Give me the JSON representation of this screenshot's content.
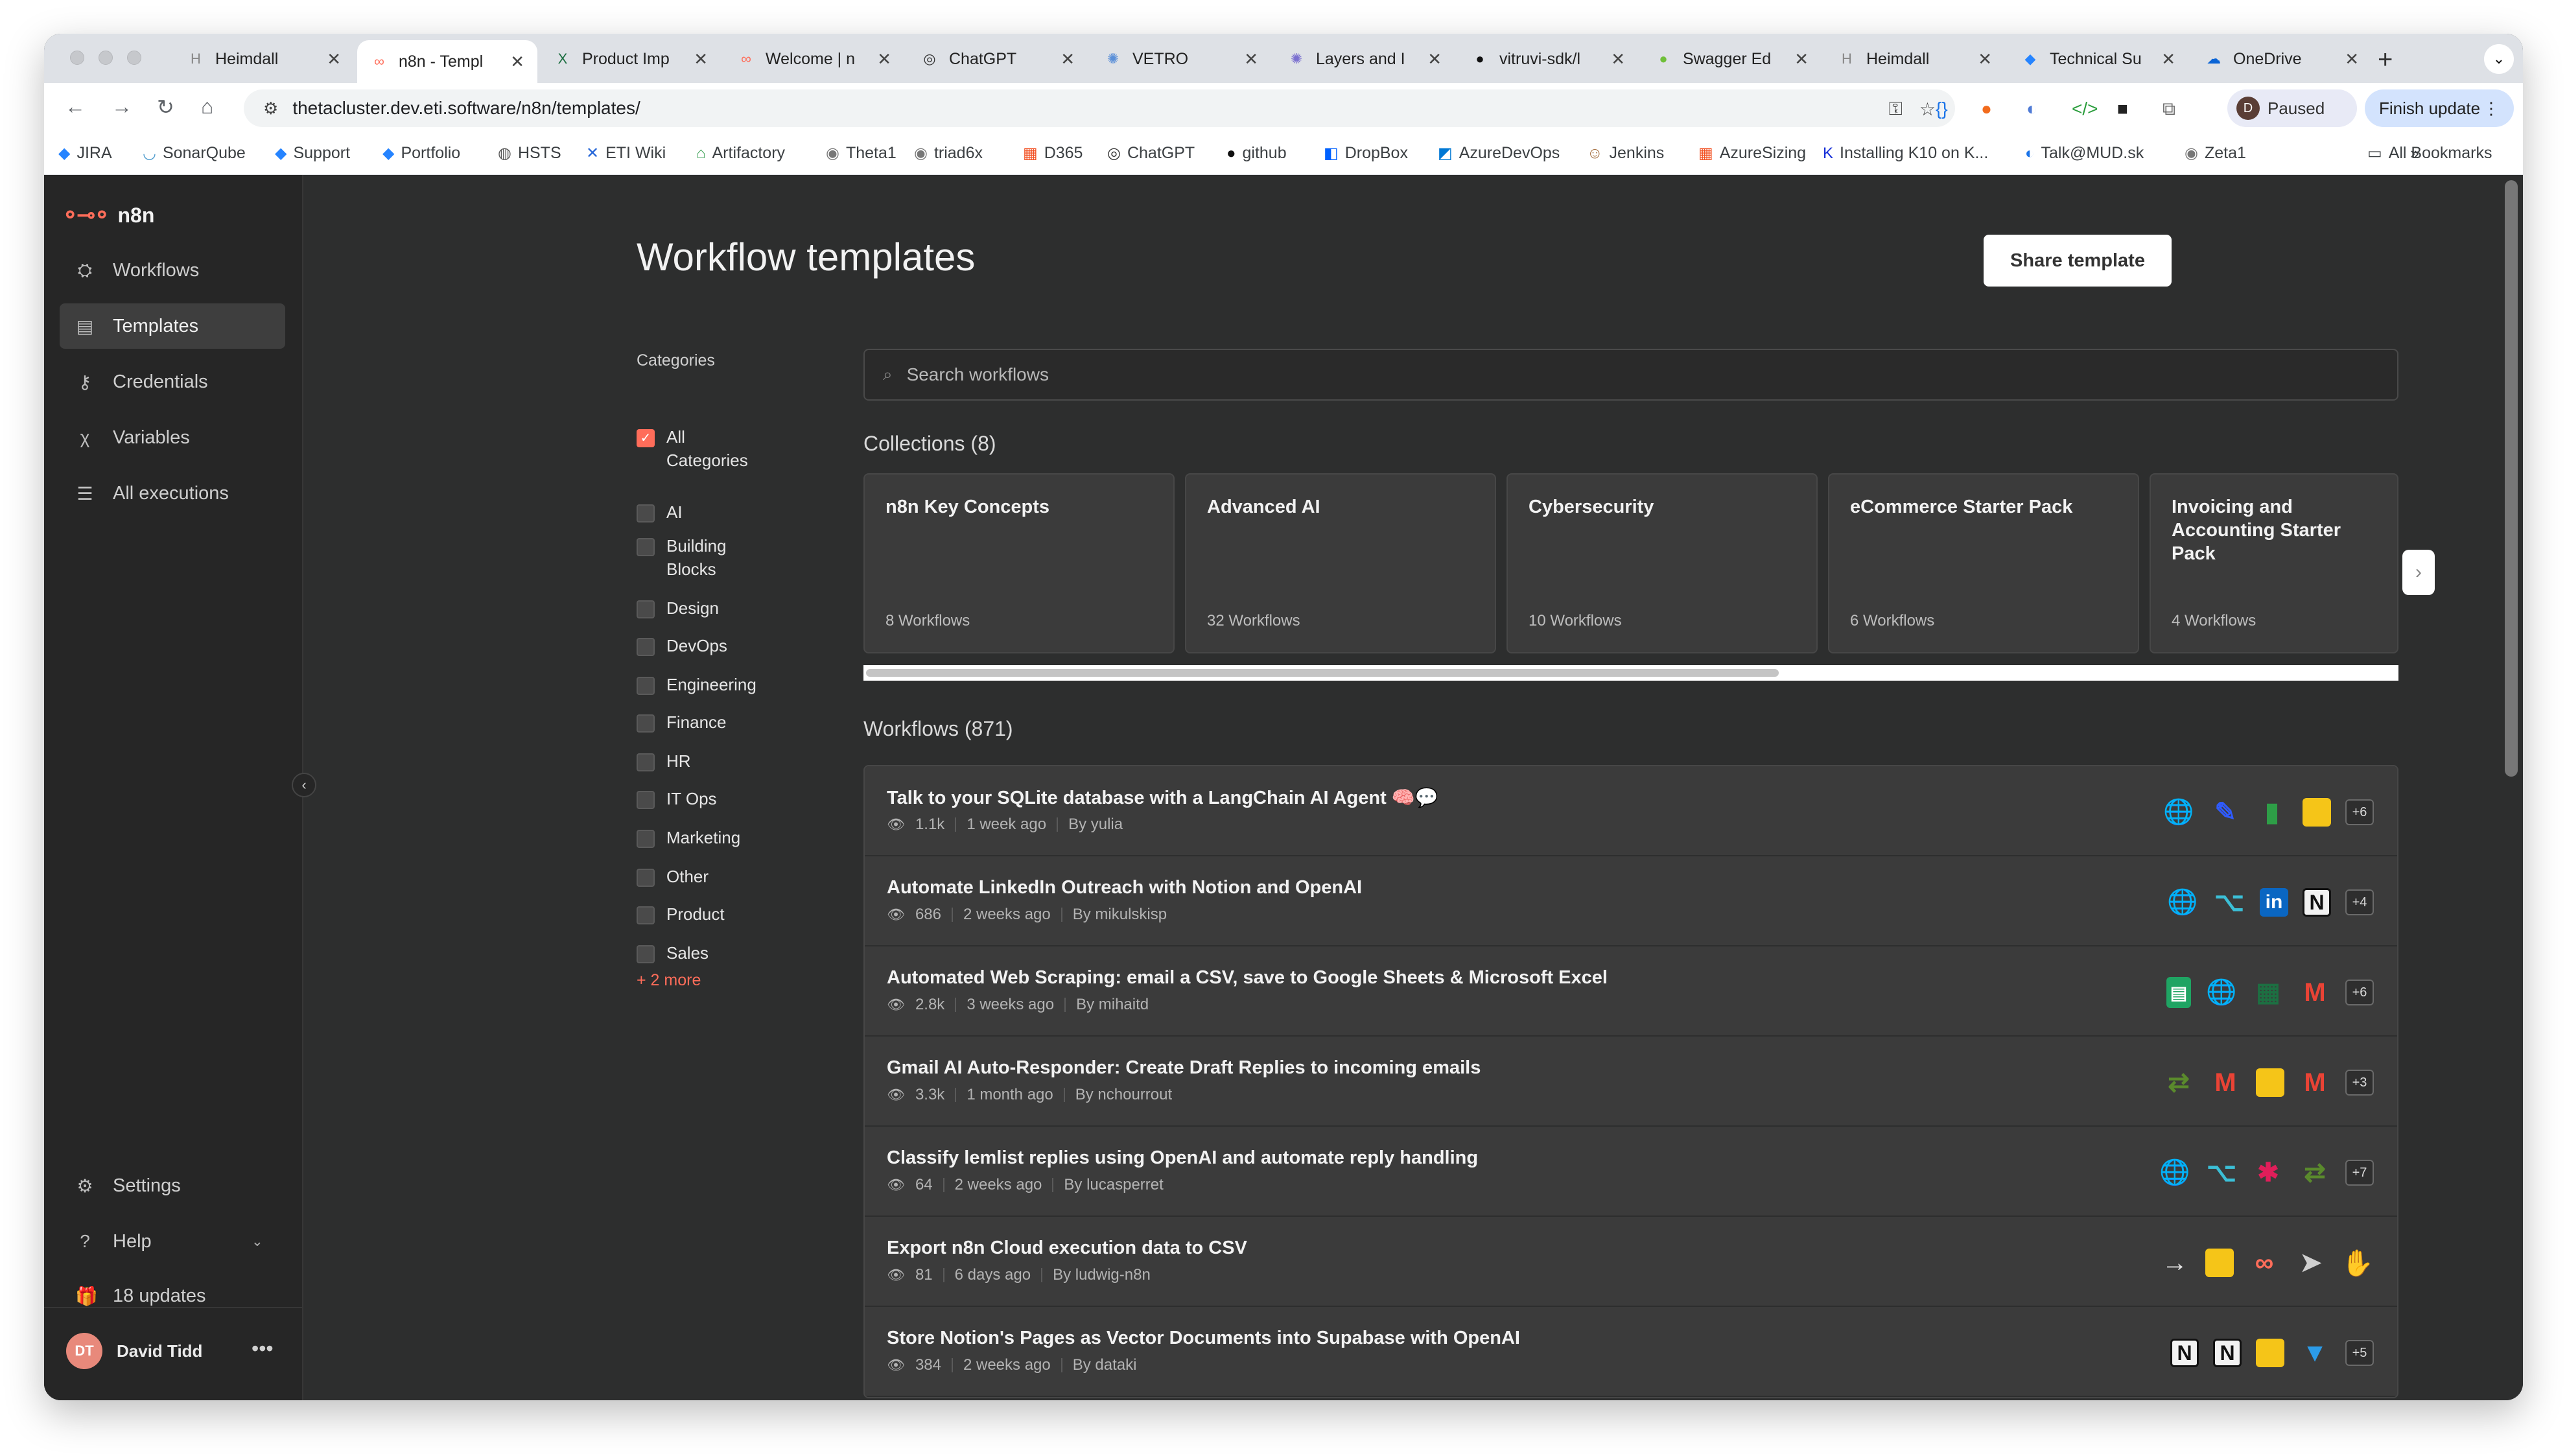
{
  "browser": {
    "tabs": [
      {
        "title": "Heimdall",
        "icon": "H",
        "active": false
      },
      {
        "title": "n8n - Templ",
        "icon": "n8n",
        "active": true
      },
      {
        "title": "Product Imp",
        "icon": "X",
        "active": false
      },
      {
        "title": "Welcome | n",
        "icon": "n8n",
        "active": false
      },
      {
        "title": "ChatGPT",
        "icon": "gpt",
        "active": false
      },
      {
        "title": "VETRO",
        "icon": "vetro",
        "active": false
      },
      {
        "title": "Layers and I",
        "icon": "layers",
        "active": false
      },
      {
        "title": "vitruvi-sdk/l",
        "icon": "github",
        "active": false
      },
      {
        "title": "Swagger Ed",
        "icon": "swagger",
        "active": false
      },
      {
        "title": "Heimdall",
        "icon": "H",
        "active": false
      },
      {
        "title": "Technical Su",
        "icon": "jira",
        "active": false
      },
      {
        "title": "OneDrive",
        "icon": "cloud",
        "active": false
      }
    ],
    "url": "thetacluster.dev.eti.software/n8n/templates/",
    "profile_initial": "D",
    "paused_label": "Paused",
    "finish_update_label": "Finish update",
    "bookmarks": [
      "JIRA",
      "SonarQube",
      "Support",
      "Portfolio",
      "HSTS",
      "ETI Wiki",
      "Artifactory",
      "Theta1",
      "triad6x",
      "D365",
      "ChatGPT",
      "github",
      "DropBox",
      "AzureDevOps",
      "Jenkins",
      "AzureSizing",
      "Installing K10 on K...",
      "Talk@MUD.sk",
      "Zeta1"
    ],
    "all_bookmarks_label": "All Bookmarks"
  },
  "sidebar": {
    "logo_text": "n8n",
    "items": [
      {
        "label": "Workflows",
        "icon": "workflows-icon",
        "active": false
      },
      {
        "label": "Templates",
        "icon": "templates-icon",
        "active": true
      },
      {
        "label": "Credentials",
        "icon": "key-icon",
        "active": false
      },
      {
        "label": "Variables",
        "icon": "variables-icon",
        "active": false
      },
      {
        "label": "All executions",
        "icon": "list-icon",
        "active": false
      }
    ],
    "bottom": {
      "settings": "Settings",
      "help": "Help",
      "updates": "18 updates"
    },
    "user": {
      "initials": "DT",
      "name": "David Tidd"
    }
  },
  "main": {
    "title": "Workflow templates",
    "share_button": "Share template",
    "categories_title": "Categories",
    "categories": [
      {
        "label": "All Categories",
        "checked": true
      },
      {
        "label": "AI",
        "checked": false
      },
      {
        "label": "Building Blocks",
        "checked": false
      },
      {
        "label": "Design",
        "checked": false
      },
      {
        "label": "DevOps",
        "checked": false
      },
      {
        "label": "Engineering",
        "checked": false
      },
      {
        "label": "Finance",
        "checked": false
      },
      {
        "label": "HR",
        "checked": false
      },
      {
        "label": "IT Ops",
        "checked": false
      },
      {
        "label": "Marketing",
        "checked": false
      },
      {
        "label": "Other",
        "checked": false
      },
      {
        "label": "Product",
        "checked": false
      },
      {
        "label": "Sales",
        "checked": false
      }
    ],
    "more_categories": "+ 2 more",
    "search_placeholder": "Search workflows",
    "collections_title": "Collections (8)",
    "collections": [
      {
        "name": "n8n Key Concepts",
        "count": "8 Workflows"
      },
      {
        "name": "Advanced AI",
        "count": "32 Workflows"
      },
      {
        "name": "Cybersecurity",
        "count": "10 Workflows"
      },
      {
        "name": "eCommerce Starter Pack",
        "count": "6 Workflows"
      },
      {
        "name": "Invoicing and Accounting Starter Pack",
        "count": "4 Workflows"
      }
    ],
    "workflows_title": "Workflows (871)",
    "workflows": [
      {
        "title": "Talk to your SQLite database with a LangChain AI Agent 🧠💬",
        "views": "1.1k",
        "age": "1 week ago",
        "author": "By yulia",
        "icons": [
          "globe",
          "pen",
          "sheet",
          "note"
        ],
        "more": "+6"
      },
      {
        "title": "Automate LinkedIn Outreach with Notion and OpenAI",
        "views": "686",
        "age": "2 weeks ago",
        "author": "By mikulskisp",
        "icons": [
          "globe",
          "branch",
          "linkedin",
          "notion"
        ],
        "more": "+4"
      },
      {
        "title": "Automated Web Scraping: email a CSV, save to Google Sheets & Microsoft Excel",
        "views": "2.8k",
        "age": "3 weeks ago",
        "author": "By mihaitd",
        "icons": [
          "gsheet",
          "globe",
          "excel",
          "gmail"
        ],
        "more": "+6"
      },
      {
        "title": "Gmail AI Auto-Responder: Create Draft Replies to incoming emails",
        "views": "3.3k",
        "age": "1 month ago",
        "author": "By nchourrout",
        "icons": [
          "signpost",
          "gmail",
          "note",
          "gmail"
        ],
        "more": "+3"
      },
      {
        "title": "Classify lemlist replies using OpenAI and automate reply handling",
        "views": "64",
        "age": "2 weeks ago",
        "author": "By lucasperret",
        "icons": [
          "globe",
          "branch",
          "slack",
          "signpost"
        ],
        "more": "+7"
      },
      {
        "title": "Export n8n Cloud execution data to CSV",
        "views": "81",
        "age": "6 days ago",
        "author": "By ludwig-n8n",
        "icons": [
          "arrow",
          "note",
          "n8n",
          "cursor",
          "blue-hand"
        ],
        "more": ""
      },
      {
        "title": "Store Notion's Pages as Vector Documents into Supabase with OpenAI",
        "views": "384",
        "age": "2 weeks ago",
        "author": "By dataki",
        "icons": [
          "notion",
          "notion",
          "note",
          "filter"
        ],
        "more": "+5"
      }
    ]
  }
}
